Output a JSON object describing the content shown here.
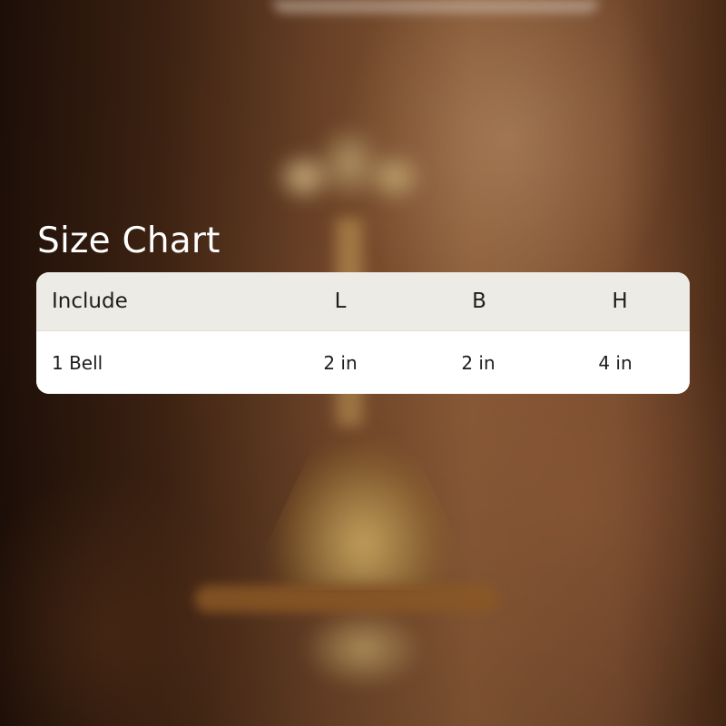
{
  "size_chart": {
    "title": "Size Chart",
    "columns": [
      "Include",
      "L",
      "B",
      "H"
    ],
    "rows": [
      [
        "1 Bell",
        "2 in",
        "2 in",
        "4 in"
      ]
    ]
  },
  "colors": {
    "title_text": "#ffffff",
    "header_background": "#edebe6",
    "body_background": "#ffffff",
    "table_text": "#1f1d1b"
  }
}
